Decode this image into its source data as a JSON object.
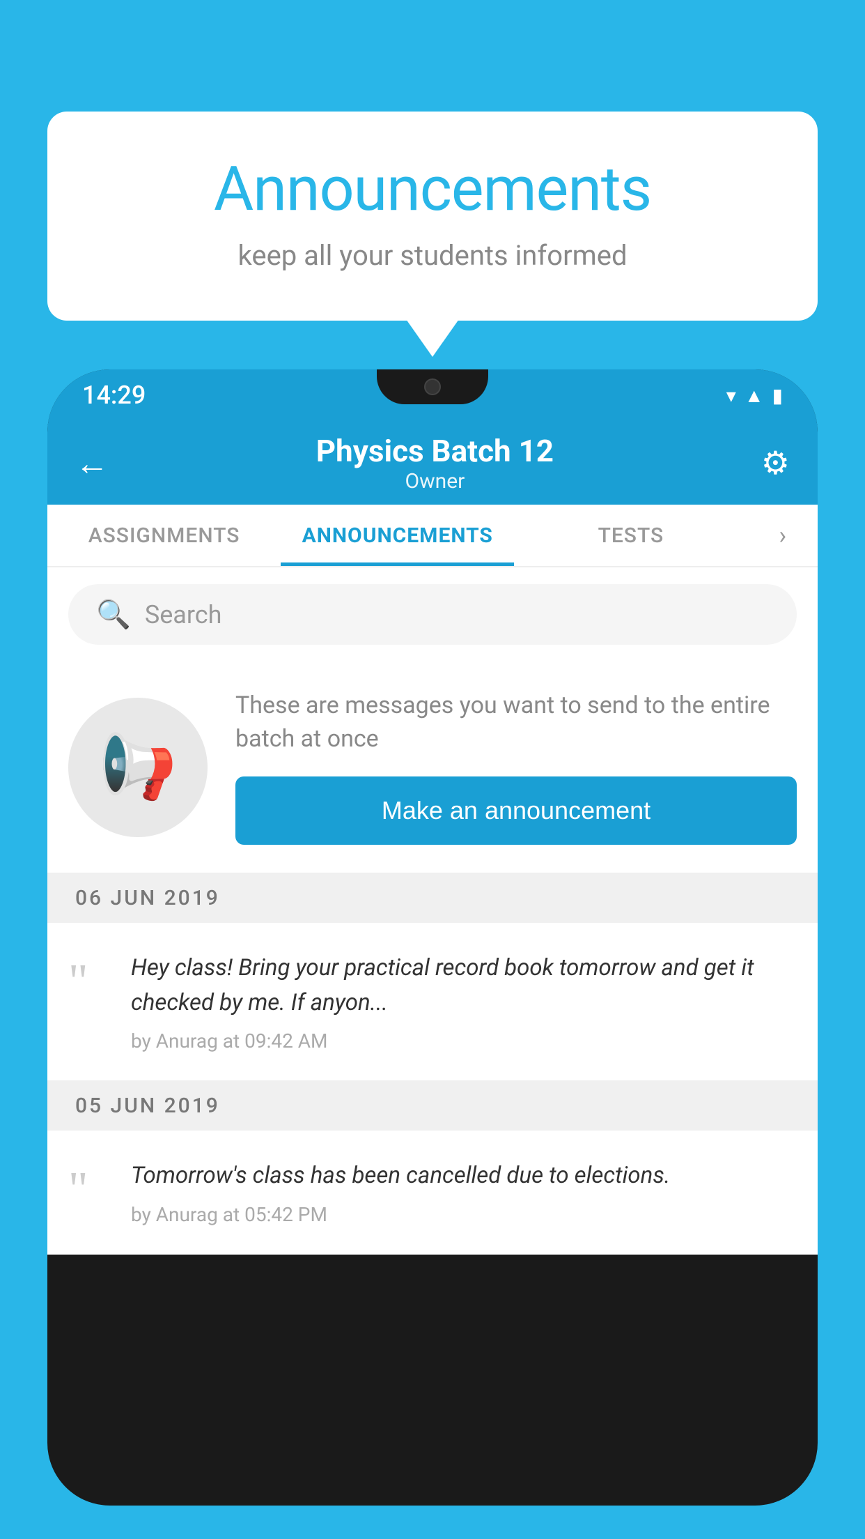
{
  "bubble": {
    "title": "Announcements",
    "subtitle": "keep all your students informed"
  },
  "phone": {
    "status": {
      "time": "14:29"
    },
    "header": {
      "back_label": "←",
      "title": "Physics Batch 12",
      "subtitle": "Owner",
      "gear_icon": "⚙"
    },
    "tabs": [
      {
        "label": "ASSIGNMENTS",
        "active": false
      },
      {
        "label": "ANNOUNCEMENTS",
        "active": true
      },
      {
        "label": "TESTS",
        "active": false
      }
    ],
    "search": {
      "placeholder": "Search"
    },
    "announcement_prompt": {
      "description": "These are messages you want to send to the entire batch at once",
      "button_label": "Make an announcement"
    },
    "announcements": [
      {
        "date": "06  JUN  2019",
        "message": "Hey class! Bring your practical record book tomorrow and get it checked by me. If anyon...",
        "meta": "by Anurag at 09:42 AM"
      },
      {
        "date": "05  JUN  2019",
        "message": "Tomorrow's class has been cancelled due to elections.",
        "meta": "by Anurag at 05:42 PM"
      }
    ]
  }
}
